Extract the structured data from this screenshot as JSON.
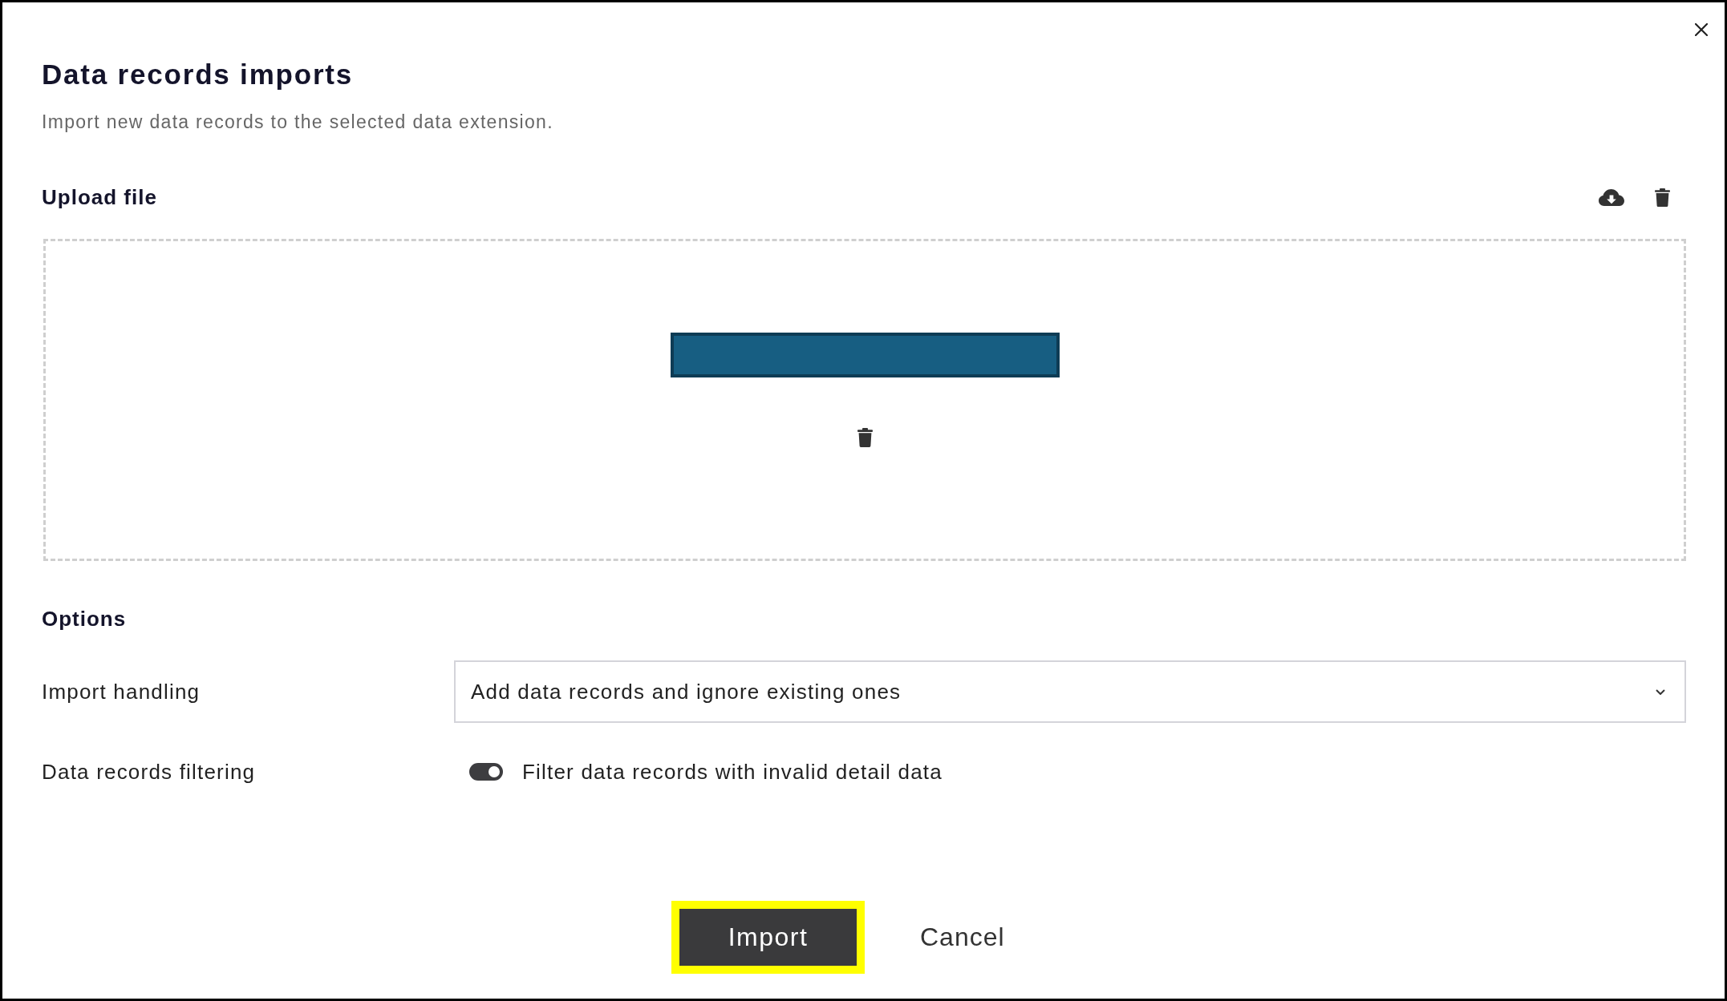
{
  "dialog": {
    "title": "Data records imports",
    "subtitle": "Import new data records to the selected data extension."
  },
  "upload": {
    "heading": "Upload file"
  },
  "options": {
    "heading": "Options",
    "import_handling": {
      "label": "Import handling",
      "value": "Add data records and ignore existing ones"
    },
    "filtering": {
      "label": "Data records filtering",
      "toggle": {
        "on": true,
        "label": "Filter data records with invalid detail data"
      }
    }
  },
  "buttons": [
    {
      "label": "Import",
      "kind": "primary",
      "highlighted": true
    },
    {
      "label": "Cancel",
      "kind": "secondary",
      "highlighted": false
    }
  ]
}
